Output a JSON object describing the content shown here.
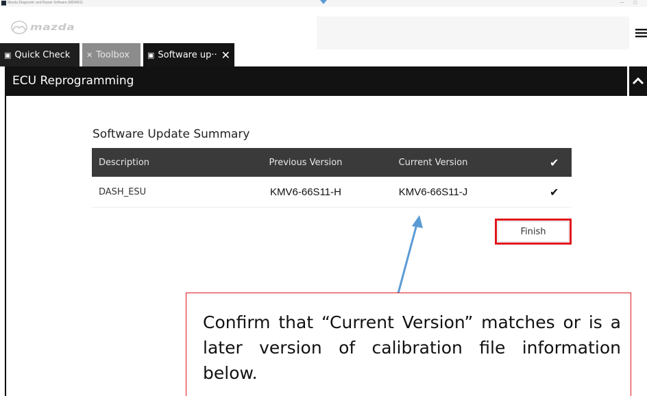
{
  "window": {
    "title": "Mazda Diagnostic and Repair Software (MDARS)",
    "min_glyph": "—",
    "max_glyph": "▢"
  },
  "header": {
    "logo_text": "mazda"
  },
  "tabs": [
    {
      "label": "Quick Check",
      "icon": "camera-icon"
    },
    {
      "label": "Toolbox",
      "icon": "tools-icon"
    },
    {
      "label": "Software up··",
      "icon": "chip-icon",
      "close": "✕"
    }
  ],
  "section": {
    "title": "ECU Reprogramming"
  },
  "summary": {
    "title": "Software Update Summary",
    "columns": [
      "Description",
      "Previous Version",
      "Current Version"
    ],
    "header_check": "✔",
    "rows": [
      {
        "description": "DASH_ESU",
        "previous": "KMV6-66S11-H",
        "current": "KMV6-66S11-J",
        "check": "✔"
      }
    ],
    "finish_label": "Finish"
  },
  "callout": {
    "text": "Confirm that “Current Version” matches or is a later version of calibration file information below."
  },
  "colors": {
    "accent_red": "#e0141b",
    "arrow_blue": "#5b9bd5",
    "dark_bar": "#121212",
    "table_header": "#3a3a3a"
  }
}
